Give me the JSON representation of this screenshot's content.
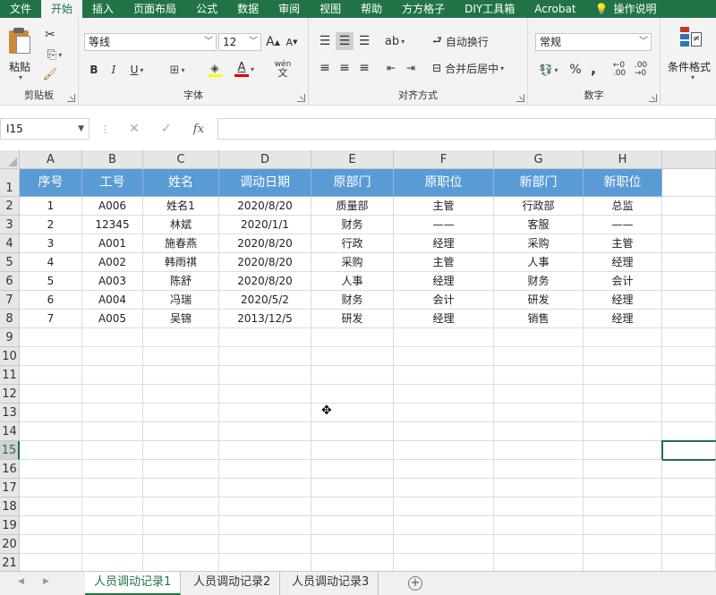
{
  "menu": {
    "tabs": [
      "文件",
      "开始",
      "插入",
      "页面布局",
      "公式",
      "数据",
      "审阅",
      "视图",
      "帮助",
      "方方格子",
      "DIY工具箱",
      "Acrobat"
    ],
    "active_index": 1,
    "tell_me": "操作说明"
  },
  "ribbon": {
    "clipboard": {
      "label": "剪贴板",
      "paste": "粘贴"
    },
    "font": {
      "label": "字体",
      "font_name": "等线",
      "font_size": "12",
      "bold": "B",
      "italic": "I",
      "underline": "U",
      "grow": "A",
      "shrink": "A",
      "font_color_glyph": "A",
      "phonetic": "wén"
    },
    "alignment": {
      "label": "对齐方式",
      "wrap": "自动换行",
      "merge": "合并后居中"
    },
    "number": {
      "label": "数字",
      "format": "常规",
      "percent": "%",
      "comma": ","
    },
    "styles": {
      "cond_format": "条件格式"
    }
  },
  "formula_bar": {
    "name_box": "I15",
    "cancel": "✕",
    "enter": "✓",
    "fx": "fx",
    "value": ""
  },
  "grid": {
    "columns": [
      "A",
      "B",
      "C",
      "D",
      "E",
      "F",
      "G",
      "H"
    ],
    "row_numbers": [
      1,
      2,
      3,
      4,
      5,
      6,
      7,
      8,
      9,
      10,
      11,
      12,
      13,
      14,
      15,
      16,
      17,
      18,
      19,
      20,
      21
    ],
    "selected_row": 15,
    "header_row": [
      "序号",
      "工号",
      "姓名",
      "调动日期",
      "原部门",
      "原职位",
      "新部门",
      "新职位"
    ],
    "rows": [
      [
        "1",
        "A006",
        "姓名1",
        "2020/8/20",
        "质量部",
        "主管",
        "行政部",
        "总监"
      ],
      [
        "2",
        "12345",
        "林斌",
        "2020/1/1",
        "财务",
        "——",
        "客服",
        "——"
      ],
      [
        "3",
        "A001",
        "施春燕",
        "2020/8/20",
        "行政",
        "经理",
        "采购",
        "主管"
      ],
      [
        "4",
        "A002",
        "韩雨祺",
        "2020/8/20",
        "采购",
        "主管",
        "人事",
        "经理"
      ],
      [
        "5",
        "A003",
        "陈舒",
        "2020/8/20",
        "人事",
        "经理",
        "财务",
        "会计"
      ],
      [
        "6",
        "A004",
        "冯瑞",
        "2020/5/2",
        "财务",
        "会计",
        "研发",
        "经理"
      ],
      [
        "7",
        "A005",
        "吴锦",
        "2013/12/5",
        "研发",
        "经理",
        "销售",
        "经理"
      ]
    ]
  },
  "sheets": [
    "人员调动记录1",
    "人员调动记录2",
    "人员调动记录3"
  ],
  "active_sheet": 0,
  "colors": {
    "excel_green": "#217346",
    "header_blue": "#5b9bd5"
  }
}
